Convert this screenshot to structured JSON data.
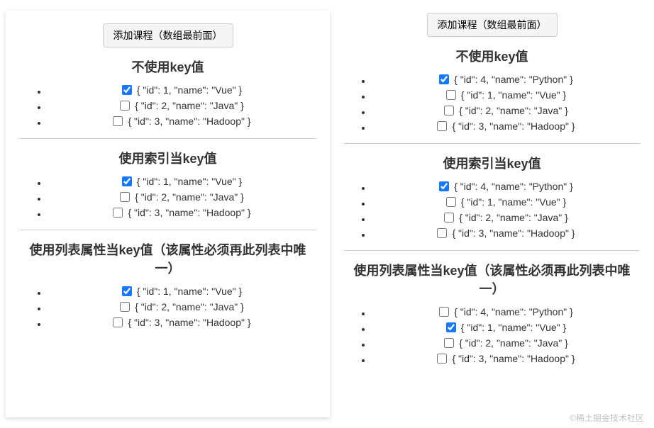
{
  "buttons": {
    "add_label": "添加课程（数组最前面）"
  },
  "sections": {
    "no_key": "不使用key值",
    "index_key": "使用索引当key值",
    "prop_key": "使用列表属性当key值（该属性必须再此列表中唯一）"
  },
  "left": {
    "no_key": [
      {
        "label": "{ \"id\": 1, \"name\": \"Vue\" }",
        "checked": true
      },
      {
        "label": "{ \"id\": 2, \"name\": \"Java\" }",
        "checked": false
      },
      {
        "label": "{ \"id\": 3, \"name\": \"Hadoop\" }",
        "checked": false
      }
    ],
    "index_key": [
      {
        "label": "{ \"id\": 1, \"name\": \"Vue\" }",
        "checked": true
      },
      {
        "label": "{ \"id\": 2, \"name\": \"Java\" }",
        "checked": false
      },
      {
        "label": "{ \"id\": 3, \"name\": \"Hadoop\" }",
        "checked": false
      }
    ],
    "prop_key": [
      {
        "label": "{ \"id\": 1, \"name\": \"Vue\" }",
        "checked": true
      },
      {
        "label": "{ \"id\": 2, \"name\": \"Java\" }",
        "checked": false
      },
      {
        "label": "{ \"id\": 3, \"name\": \"Hadoop\" }",
        "checked": false
      }
    ]
  },
  "right": {
    "no_key": [
      {
        "label": "{ \"id\": 4, \"name\": \"Python\" }",
        "checked": true
      },
      {
        "label": "{ \"id\": 1, \"name\": \"Vue\" }",
        "checked": false
      },
      {
        "label": "{ \"id\": 2, \"name\": \"Java\" }",
        "checked": false
      },
      {
        "label": "{ \"id\": 3, \"name\": \"Hadoop\" }",
        "checked": false
      }
    ],
    "index_key": [
      {
        "label": "{ \"id\": 4, \"name\": \"Python\" }",
        "checked": true
      },
      {
        "label": "{ \"id\": 1, \"name\": \"Vue\" }",
        "checked": false
      },
      {
        "label": "{ \"id\": 2, \"name\": \"Java\" }",
        "checked": false
      },
      {
        "label": "{ \"id\": 3, \"name\": \"Hadoop\" }",
        "checked": false
      }
    ],
    "prop_key": [
      {
        "label": "{ \"id\": 4, \"name\": \"Python\" }",
        "checked": false
      },
      {
        "label": "{ \"id\": 1, \"name\": \"Vue\" }",
        "checked": true
      },
      {
        "label": "{ \"id\": 2, \"name\": \"Java\" }",
        "checked": false
      },
      {
        "label": "{ \"id\": 3, \"name\": \"Hadoop\" }",
        "checked": false
      }
    ]
  },
  "watermark": "©稀土掘金技术社区"
}
